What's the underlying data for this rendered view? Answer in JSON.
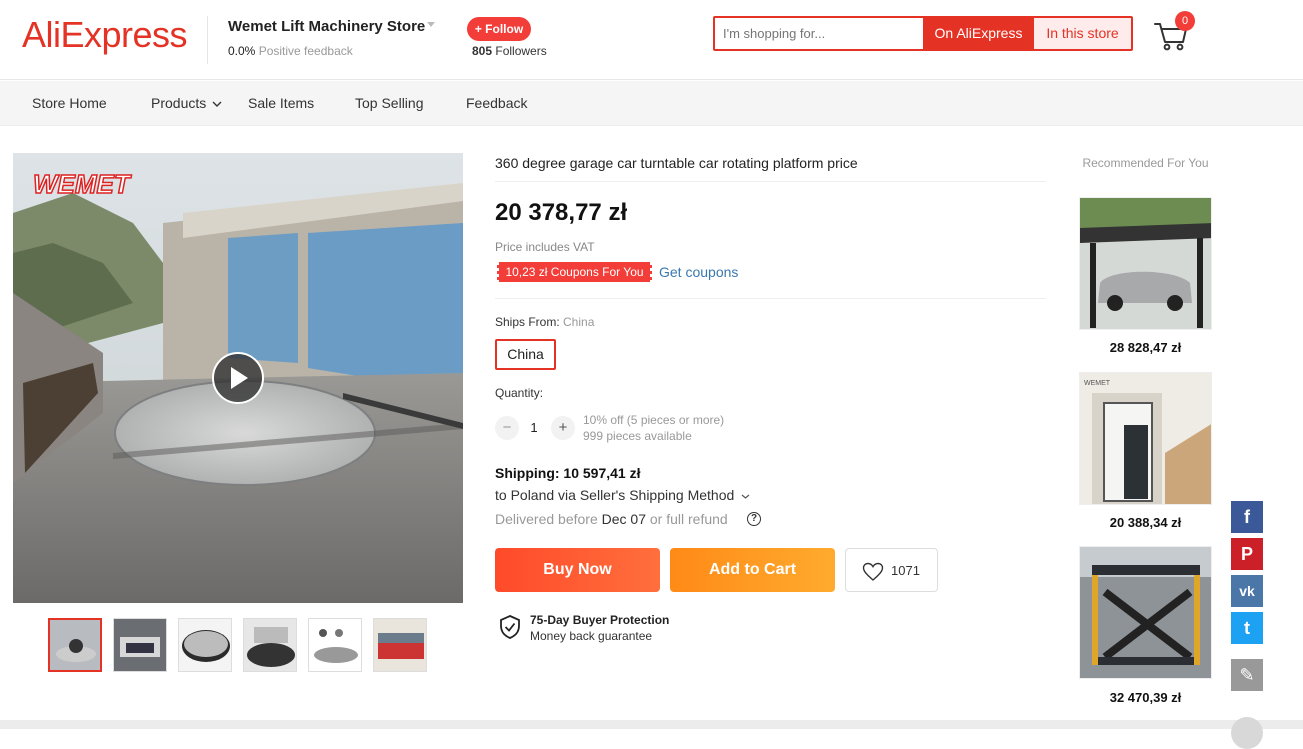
{
  "header": {
    "logo": "AliExpress",
    "store_name": "Wemet Lift Machinery Store",
    "feedback_value": "0.0%",
    "feedback_label": " Positive feedback",
    "follow_label": "+ Follow",
    "followers_count": "805",
    "followers_label": " Followers",
    "search_placeholder": "I'm shopping for...",
    "search_all_label": "On AliExpress",
    "search_store_label": "In this store",
    "cart_count": "0",
    "accent_color": "#e43225"
  },
  "nav": {
    "items": [
      "Store Home",
      "Products",
      "Sale Items",
      "Top Selling",
      "Feedback"
    ]
  },
  "gallery": {
    "brand_watermark": "WEMET",
    "thumbnail_count": 6,
    "active_thumbnail": 1
  },
  "product": {
    "title": "360 degree garage car turntable car rotating platform price",
    "price": "20 378,77 zł",
    "vat_note": "Price includes VAT",
    "coupon_badge": "10,23 zł Coupons For You",
    "get_coupons": "Get coupons",
    "ships_from_label": "Ships From: ",
    "ships_from_value": "China",
    "ship_option": "China",
    "quantity_label": "Quantity:",
    "quantity_value": "1",
    "qty_minus": "−",
    "qty_plus": "+",
    "discount_note": "10% off (5 pieces or more)",
    "available": "999 pieces available",
    "shipping": "Shipping: 10 597,41 zł",
    "ship_method": "to Poland via Seller's Shipping Method",
    "delivered_prefix": "Delivered before ",
    "delivered_date": "Dec 07",
    "delivered_suffix": " or full refund",
    "help_glyph": "?",
    "buy_now": "Buy Now",
    "add_to_cart": "Add to Cart",
    "wishlist_count": "1071",
    "protection_title": "75-Day Buyer Protection",
    "protection_sub": "Money back guarantee"
  },
  "recommended": {
    "title": "Recommended For You",
    "items": [
      {
        "price": "28 828,47 zł"
      },
      {
        "price": "20 388,34 zł"
      },
      {
        "price": "32 470,39 zł"
      }
    ]
  },
  "social": {
    "items": [
      {
        "icon": "facebook-icon",
        "glyph": "f",
        "color": "#3b5998"
      },
      {
        "icon": "pinterest-icon",
        "glyph": "P",
        "color": "#cb2027"
      },
      {
        "icon": "vk-icon",
        "glyph": "vk",
        "color": "#4a76a8"
      },
      {
        "icon": "twitter-icon",
        "glyph": "t",
        "color": "#1da1f2"
      },
      {
        "icon": "edit-icon",
        "glyph": "✎",
        "color": "#999999"
      }
    ]
  }
}
